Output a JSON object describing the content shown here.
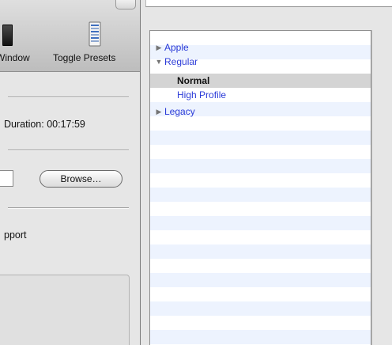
{
  "toolbar": {
    "window_label": "Window",
    "toggle_presets_label": "Toggle Presets",
    "icons": {
      "window": "window-icon",
      "presets": "presets-list-icon"
    }
  },
  "source": {
    "duration_text": "Duration: 00:17:59"
  },
  "destination": {
    "path_value": "",
    "browse_label": "Browse…"
  },
  "options": {
    "support_text": "pport"
  },
  "presets": {
    "items": [
      {
        "label": "Apple",
        "level": 0,
        "disclosure": "collapsed",
        "disclosure_glyph": "▶",
        "selected": false
      },
      {
        "label": "Regular",
        "level": 0,
        "disclosure": "expanded",
        "disclosure_glyph": "▼",
        "selected": false
      },
      {
        "label": "Normal",
        "level": 1,
        "selected": true
      },
      {
        "label": "High Profile",
        "level": 1,
        "selected": false
      },
      {
        "label": "Legacy",
        "level": 0,
        "disclosure": "collapsed",
        "disclosure_glyph": "▶",
        "selected": false
      }
    ]
  },
  "colors": {
    "preset_text": "#2b3bd8",
    "selected_row": "#d4d4d4",
    "alternate_row": "#edf3fe"
  }
}
